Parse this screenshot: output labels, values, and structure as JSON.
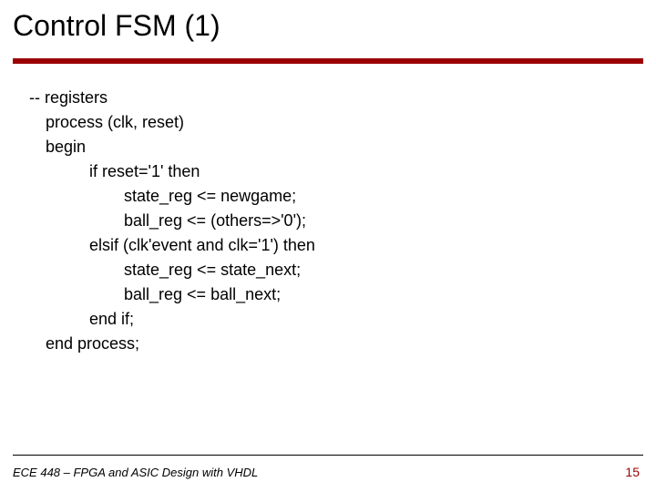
{
  "title": "Control FSM (1)",
  "code": {
    "l0": "-- registers",
    "l1": "process (clk, reset)",
    "l2": "begin",
    "l3": "if reset='1' then",
    "l4": "state_reg <= newgame;",
    "l5": "ball_reg <= (others=>'0');",
    "l6": "elsif (clk'event and clk='1') then",
    "l7": "state_reg <= state_next;",
    "l8": "ball_reg <= ball_next;",
    "l9": "end if;",
    "l10": "end process;"
  },
  "footer": {
    "left": "ECE 448 – FPGA and ASIC Design with VHDL",
    "right": "15"
  }
}
